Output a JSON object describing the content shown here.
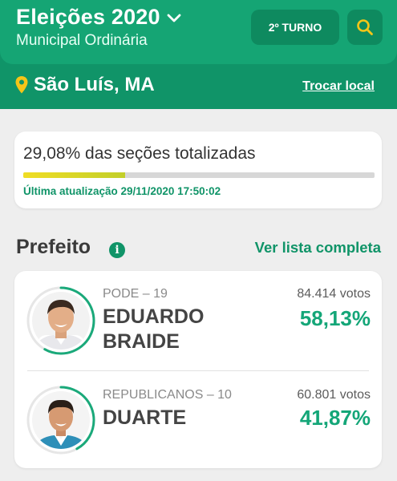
{
  "header": {
    "title": "Eleições 2020",
    "subtitle": "Municipal Ordinária",
    "turno_label": "2º TURNO",
    "city": "São Luís, MA",
    "change_location_label": "Trocar local"
  },
  "progress": {
    "text": "29,08% das seções totalizadas",
    "fraction": 0.2908,
    "updated": "Última atualização 29/11/2020 17:50:02"
  },
  "section": {
    "title": "Prefeito",
    "info_icon": "i",
    "full_list_label": "Ver lista completa"
  },
  "candidates": [
    {
      "party": "PODE – 19",
      "name_line1": "EDUARDO",
      "name_line2": "BRAIDE",
      "votes": "84.414 votos",
      "percent": "58,13%",
      "share": 0.5813
    },
    {
      "party": "REPUBLICANOS – 10",
      "name_line1": "DUARTE",
      "votes": "60.801 votos",
      "percent": "41,87%",
      "share": 0.4187
    }
  ],
  "colors": {
    "header_dark": "#109468",
    "header_light": "#15a574",
    "accent_green": "#14a678",
    "pin_yellow": "#f5c518",
    "progress_yellow": "#f0dd24"
  },
  "icons": {
    "chevron": "chevron-down-icon",
    "search": "search-icon",
    "location": "location-pin-icon",
    "info": "info-icon"
  }
}
